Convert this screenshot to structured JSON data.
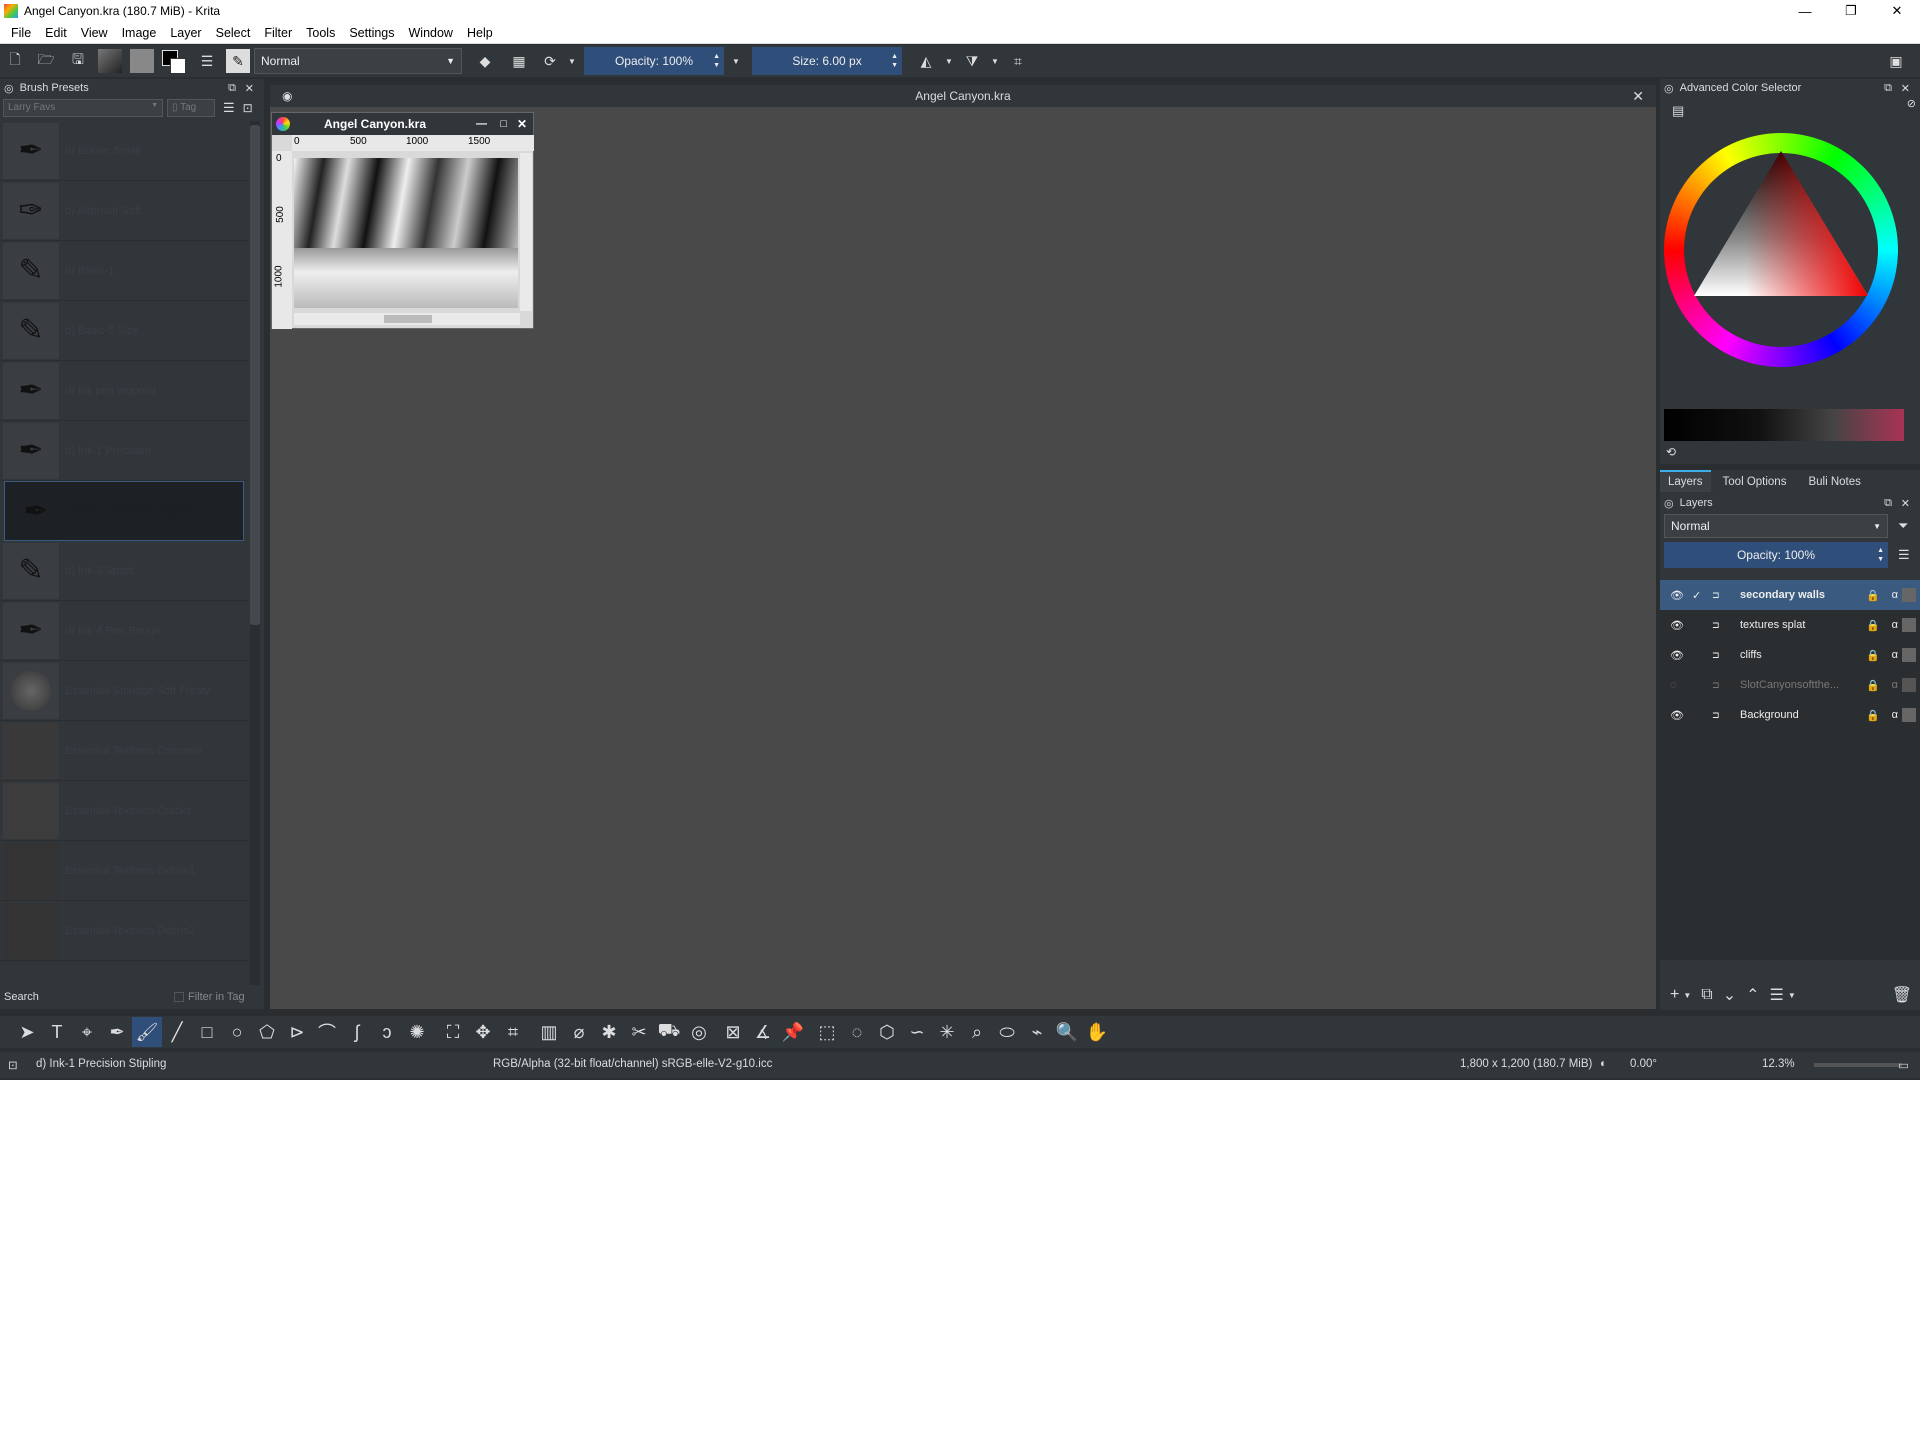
{
  "window": {
    "title": "Angel Canyon.kra (180.7 MiB)  - Krita",
    "controls": [
      "—",
      "❐",
      "✕"
    ]
  },
  "menu": [
    "File",
    "Edit",
    "View",
    "Image",
    "Layer",
    "Select",
    "Filter",
    "Tools",
    "Settings",
    "Window",
    "Help"
  ],
  "toolbar": {
    "blend_mode": "Normal",
    "opacity": "Opacity: 100%",
    "size": "Size: 6.00 px"
  },
  "brush_presets": {
    "title": "Brush Presets",
    "tag_filter": "Larry Favs",
    "tag_button": "Tag",
    "items": [
      "b) Eraser Small",
      "b) Airbrush Soft",
      "b) Basic-1",
      "b) Basic-5 Size",
      "d) Ink pen Ingpoint",
      "d) Ink-1 Precision",
      "d) Ink-1 Precision Stipling",
      "d) Ink-3 Sparti",
      "d) Ink-4 Pen Rough",
      "Essential Smudge Soft Fresty",
      "Essential Textures Concrete",
      "Essential Textures Cracks",
      "Essential Textures Debris1",
      "Essential Textures Debris2"
    ],
    "selected_index": 6,
    "search_label": "Search",
    "filter_in_tag": "Filter in Tag"
  },
  "document": {
    "tab_title": "Angel Canyon.kra",
    "subwindow_title": "Angel Canyon.kra",
    "ruler_h": [
      "0",
      "500",
      "1000",
      "1500"
    ],
    "ruler_v": [
      "0",
      "500",
      "1000"
    ]
  },
  "color_selector": {
    "title": "Advanced Color Selector"
  },
  "right_tabs": [
    "Layers",
    "Tool Options",
    "Buli Notes"
  ],
  "layers": {
    "title": "Layers",
    "blend_mode": "Normal",
    "opacity": "Opacity:  100%",
    "items": [
      {
        "name": "secondary walls",
        "visible": true,
        "active": true
      },
      {
        "name": "textures splat",
        "visible": true,
        "active": false
      },
      {
        "name": "cliffs",
        "visible": true,
        "active": false
      },
      {
        "name": "SlotCanyonsoftthe...",
        "visible": false,
        "active": false
      },
      {
        "name": "Background",
        "visible": true,
        "active": false
      }
    ]
  },
  "status": {
    "brush": "d) Ink-1 Precision Stipling",
    "color_model": "RGB/Alpha (32-bit float/channel)  sRGB-elle-V2-g10.icc",
    "dimensions": "1,800 x 1,200 (180.7 MiB)",
    "rotation": "0.00°",
    "zoom": "12.3%"
  },
  "colors": {
    "bg": "#2b2e31",
    "panel": "#31363b",
    "canvas": "#494949",
    "accent": "#2f4f7a"
  }
}
